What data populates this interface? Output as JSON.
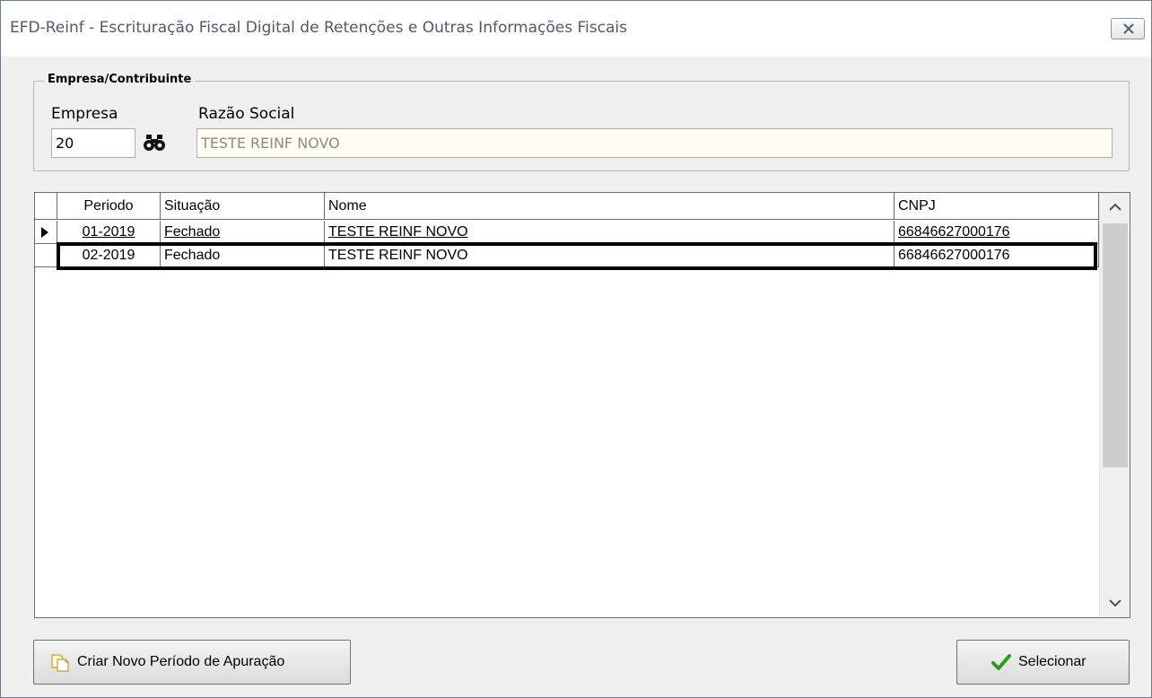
{
  "window": {
    "title": "EFD-Reinf - Escrituração Fiscal Digital de Retenções e Outras Informações Fiscais"
  },
  "company_group": {
    "legend": "Empresa/Contribuinte",
    "empresa_label": "Empresa",
    "empresa_value": "20",
    "razao_label": "Razão Social",
    "razao_value": "TESTE REINF NOVO"
  },
  "grid": {
    "columns": [
      "Periodo",
      "Situação",
      "Nome",
      "CNPJ"
    ],
    "rows": [
      {
        "periodo": "01-2019",
        "situacao": "Fechado",
        "nome": "TESTE REINF NOVO",
        "cnpj": "66846627000176"
      },
      {
        "periodo": "02-2019",
        "situacao": "Fechado",
        "nome": "TESTE REINF NOVO",
        "cnpj": "66846627000176"
      }
    ],
    "current_row_indicator": "▶"
  },
  "buttons": {
    "novo_label": "Criar Novo Período de Apuração",
    "selecionar_label": "Selecionar"
  },
  "icons": {
    "close": "close-icon",
    "search": "binoculars-icon",
    "new": "new-document-icon",
    "confirm": "checkmark-icon"
  },
  "colors": {
    "readonly_field_bg": "#fffdf0",
    "check_green": "#2e9b1f"
  }
}
